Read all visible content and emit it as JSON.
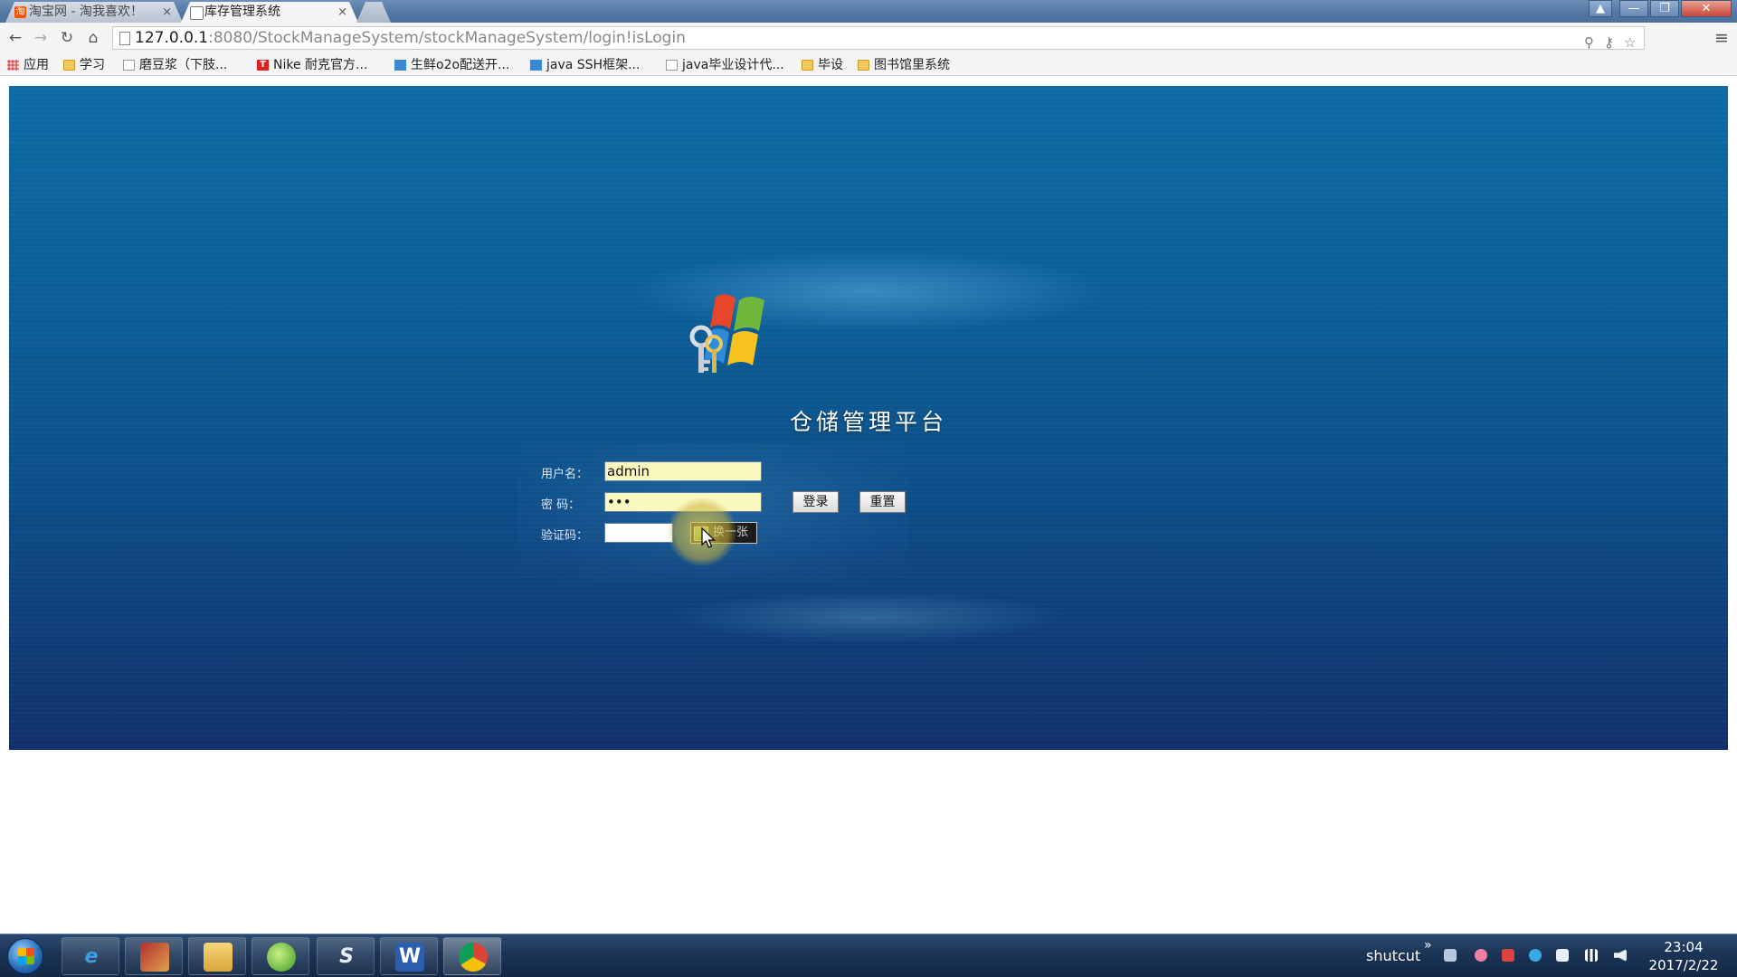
{
  "browser": {
    "tabs": [
      {
        "title": "淘宝网 - 淘我喜欢！",
        "favicon": "taobao-icon",
        "close": "×"
      },
      {
        "title": "库存管理系统",
        "favicon": "page-icon",
        "close": "×"
      }
    ],
    "url_host": "127.0.0.1",
    "url_rest": ":8080/StockManageSystem/stockManageSystem/login!isLogin",
    "window_controls": {
      "user": "▲",
      "minimize": "—",
      "maximize": "❐",
      "close": "✕"
    },
    "nav": {
      "back": "←",
      "forward": "→",
      "reload": "↻",
      "home": "⌂"
    },
    "omnibox_actions": {
      "zoom": "⚲",
      "key": "⚷",
      "star": "☆",
      "menu": "≡"
    }
  },
  "bookmarks": [
    {
      "label": "应用",
      "icon": "apps-grid-icon"
    },
    {
      "label": "学习",
      "icon": "folder-icon"
    },
    {
      "label": "磨豆浆（下肢...",
      "icon": "page-icon"
    },
    {
      "label": "Nike 耐克官方...",
      "icon": "nike-icon"
    },
    {
      "label": "生鲜o2o配送开...",
      "icon": "site-icon"
    },
    {
      "label": "java SSH框架...",
      "icon": "site-icon"
    },
    {
      "label": "java毕业设计代...",
      "icon": "page-icon"
    },
    {
      "label": "毕设",
      "icon": "folder-icon"
    },
    {
      "label": "图书馆里系统",
      "icon": "folder-icon"
    }
  ],
  "login": {
    "platform_title": "仓储管理平台",
    "username_label": "用户名：",
    "username_value": "admin",
    "password_label": "密  码：",
    "password_value": "•••",
    "captcha_label": "验证码：",
    "captcha_value": "",
    "captcha_image_text": "换一张",
    "login_button": "登录",
    "reset_button": "重置"
  },
  "taskbar": {
    "apps": [
      "ie-icon",
      "media-icon",
      "explorer-icon",
      "leaf-app-icon",
      "s-app-icon",
      "word-icon",
      "chrome-icon"
    ],
    "word_glyph": "W",
    "s_glyph": "S",
    "tray_label": "shutcut",
    "tray_chevron": "»",
    "time": "23:04",
    "date": "2017/2/22"
  },
  "colors": {
    "banner_top": "#0d6aa4",
    "banner_bottom": "#11306b",
    "input_fill": "#fbf8bf",
    "title_text": "#ffffff"
  }
}
